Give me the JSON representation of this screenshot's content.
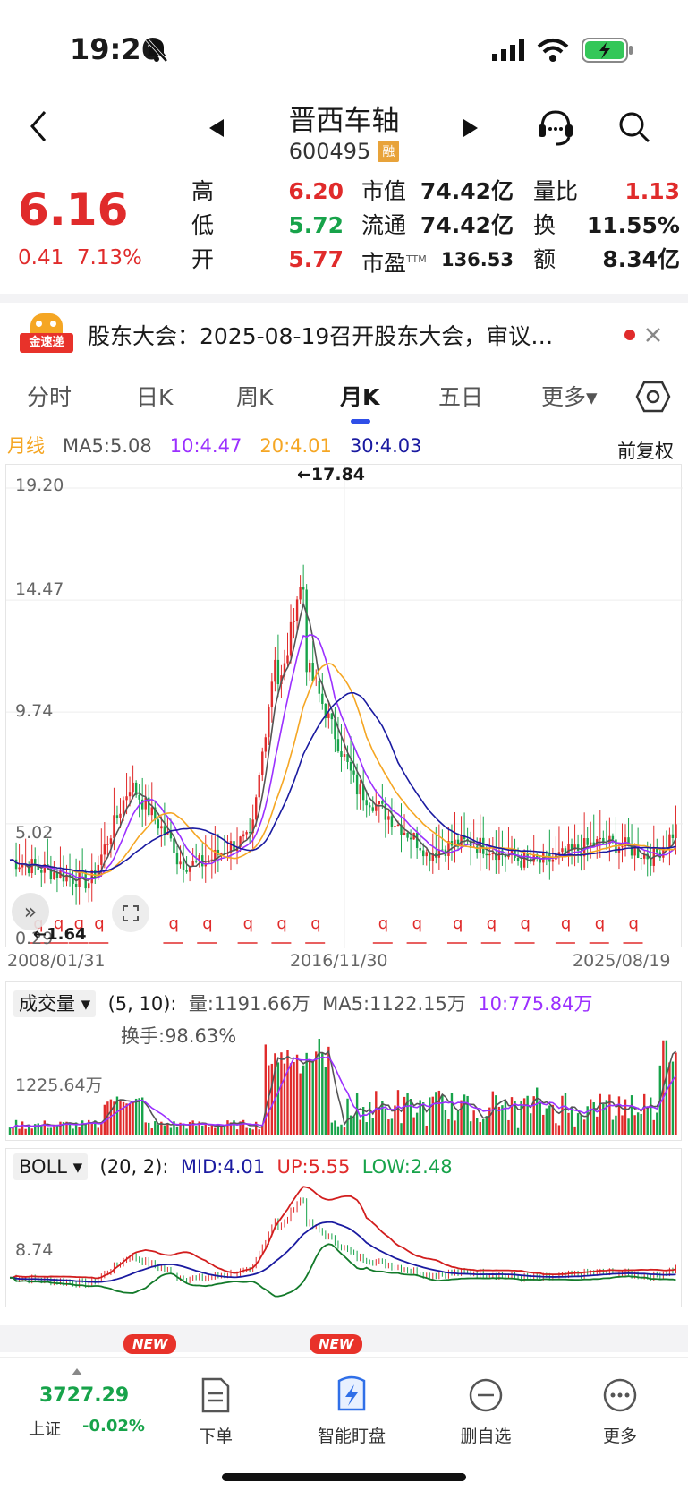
{
  "status": {
    "time": "19:26"
  },
  "header": {
    "title": "晋西车轴",
    "code": "600495",
    "tag": "融"
  },
  "quote": {
    "price": "6.16",
    "change": "0.41",
    "change_pct": "7.13%",
    "labels": {
      "high": "高",
      "low": "低",
      "open": "开",
      "mkt_cap": "市值",
      "float": "流通",
      "pe": "市盈",
      "pe_sup": "TTM",
      "vol_ratio": "量比",
      "turnover": "换",
      "amount": "额"
    },
    "high": "6.20",
    "low": "5.72",
    "open": "5.77",
    "mkt_cap": "74.42亿",
    "float": "74.42亿",
    "pe": "136.53",
    "vol_ratio": "1.13",
    "turnover": "11.55%",
    "amount": "8.34亿"
  },
  "news": {
    "badge": "金速递",
    "text": "股东大会：2025-08-19召开股东大会，审议…"
  },
  "tabs": [
    "分时",
    "日K",
    "周K",
    "月K",
    "五日",
    "更多▾"
  ],
  "kline": {
    "period": "月线",
    "ma5": "MA5:5.08",
    "ma10": "10:4.47",
    "ma20": "20:4.01",
    "ma30": "30:4.03",
    "adjust": "前复权",
    "y_labels": [
      "19.20",
      "14.47",
      "9.74",
      "5.02",
      "0.29"
    ],
    "max_note": "←17.84",
    "min_note": "←1.64",
    "x_labels": [
      "2008/01/31",
      "2016/11/30",
      "2025/08/19"
    ],
    "event_mark": "q",
    "colors": {
      "up": "#e02b2b",
      "down": "#17a34a",
      "ma5": "#555555",
      "ma10": "#9b30ff",
      "ma20": "#f5a623",
      "ma30": "#1a1aa0"
    }
  },
  "volume": {
    "selector": "成交量",
    "params": "(5, 10):",
    "vol": "量:1191.66万",
    "ma5": "MA5:1122.15万",
    "ma10": "10:775.84万",
    "turnover": "换手:98.63%",
    "y_label": "1225.64万"
  },
  "boll": {
    "selector": "BOLL",
    "params": "(20, 2):",
    "mid": "MID:4.01",
    "up": "UP:5.55",
    "low": "LOW:2.48",
    "y_label": "8.74"
  },
  "bottom": {
    "index_value": "3727.29",
    "index_name": "上证",
    "index_chg": "-0.02%",
    "new_tag": "NEW",
    "items": [
      {
        "label": "下单",
        "icon": "order-doc-icon"
      },
      {
        "label": "智能盯盘",
        "icon": "lightning-icon"
      },
      {
        "label": "删自选",
        "icon": "remove-circle-icon"
      },
      {
        "label": "更多",
        "icon": "more-icon"
      }
    ]
  },
  "chart_data": [
    {
      "type": "candlestick",
      "title": "月线",
      "x_range": [
        "2008/01/31",
        "2025/08/19"
      ],
      "ylim": [
        0.29,
        19.2
      ],
      "high_mark": 17.84,
      "low_mark": 1.64,
      "series": [
        {
          "name": "MA5",
          "last": 5.08
        },
        {
          "name": "MA10",
          "last": 4.47
        },
        {
          "name": "MA20",
          "last": 4.01
        },
        {
          "name": "MA30",
          "last": 4.03
        }
      ]
    },
    {
      "type": "bar",
      "title": "成交量",
      "series": [
        {
          "name": "量",
          "last": "1191.66万"
        },
        {
          "name": "MA5",
          "last": "1122.15万"
        },
        {
          "name": "10",
          "last": "775.84万"
        }
      ]
    },
    {
      "type": "line",
      "title": "BOLL",
      "series": [
        {
          "name": "MID",
          "last": 4.01
        },
        {
          "name": "UP",
          "last": 5.55
        },
        {
          "name": "LOW",
          "last": 2.48
        }
      ]
    }
  ]
}
